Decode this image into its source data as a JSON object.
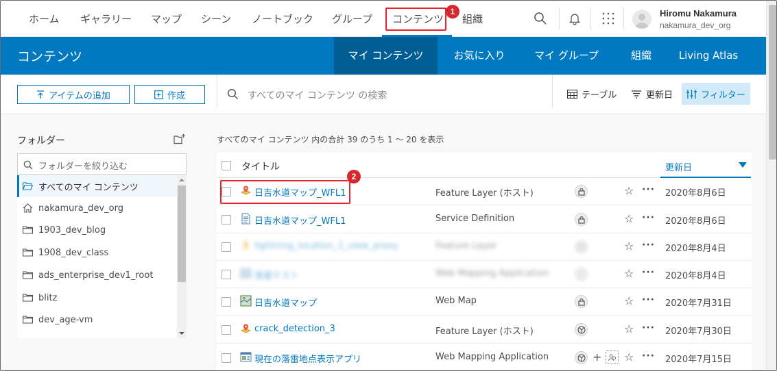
{
  "nav": {
    "items": [
      "ホーム",
      "ギャラリー",
      "マップ",
      "シーン",
      "ノートブック",
      "グループ",
      "コンテンツ",
      "組織"
    ],
    "active": "コンテンツ",
    "callout_1": "1",
    "icons": [
      "search-icon",
      "bell-icon",
      "apps-grid-icon"
    ],
    "user": {
      "name": "Hiromu Nakamura",
      "org": "nakamura_dev_org"
    }
  },
  "content_bar": {
    "title": "コンテンツ",
    "tabs": [
      "マイ コンテンツ",
      "お気に入り",
      "マイ グループ",
      "組織",
      "Living Atlas"
    ],
    "active_tab": "マイ コンテンツ"
  },
  "toolbar": {
    "add_item": "アイテムの追加",
    "create": "作成",
    "search_placeholder": "すべてのマイ コンテンツ の検索",
    "table": "テーブル",
    "sort": "更新日",
    "filter": "フィルター"
  },
  "folders": {
    "heading": "フォルダー",
    "filter_placeholder": "フォルダーを絞り込む",
    "items": [
      "すべてのマイ コンテンツ",
      "nakamura_dev_org",
      "1903_dev_blog",
      "1908_dev_class",
      "ads_enterprise_dev1_root",
      "blitz",
      "dev_age-vm"
    ],
    "selected": "すべてのマイ コンテンツ"
  },
  "list": {
    "summary": "すべてのマイ コンテンツ 内の合計 39 のうち 1 〜 20 を表示",
    "header_title": "タイトル",
    "header_sort": "更新日",
    "callout_2": "2",
    "rows": [
      {
        "title": "日吉水道マップ_WFL1",
        "type": "Feature Layer (ホスト)",
        "date": "2020年8月6日",
        "icon": "feature-layer-icon",
        "share": "private-lock-icon"
      },
      {
        "title": "日吉水道マップ_WFL1",
        "type": "Service Definition",
        "date": "2020年8月6日",
        "icon": "service-definition-icon",
        "share": "private-lock-icon"
      },
      {
        "title": "lightning_location_1_view_proxy",
        "type": "Feature Layer",
        "date": "2020年8月4日",
        "icon": "feature-layer-icon",
        "share": "shared-icon"
      },
      {
        "title": "落雷テスト",
        "type": "Web Mapping Application",
        "date": "2020年8月4日",
        "icon": "web-app-icon",
        "share": "private-lock-icon"
      },
      {
        "title": "日吉水道マップ",
        "type": "Web Map",
        "date": "2020年7月31日",
        "icon": "web-map-icon",
        "share": "private-lock-icon"
      },
      {
        "title": "crack_detection_3",
        "type": "Feature Layer (ホスト)",
        "date": "2020年7月30日",
        "icon": "feature-layer-icon",
        "share": "public-globe-icon"
      },
      {
        "title": "現在の落雷地点表示アプリ",
        "type": "Web Mapping Application",
        "date": "2020年7月15日",
        "icon": "web-app-icon",
        "share": "public-globe-icon"
      }
    ]
  },
  "colors": {
    "brand_blue": "#0079c1",
    "dark_blue": "#005e95",
    "callout_red": "#e8232a"
  }
}
